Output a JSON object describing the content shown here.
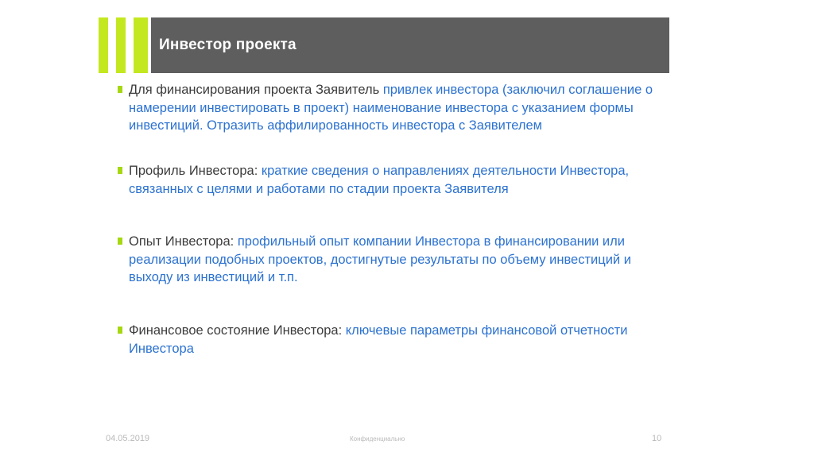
{
  "slide": {
    "title": "Инвестор проекта",
    "bullets": [
      {
        "lead": "Для финансирования проекта Заявитель ",
        "detail": "привлек инвестора (заключил соглашение о намерении инвестировать в проект) наименование инвестора с указанием формы инвестиций. Отразить аффилированность инвестора с Заявителем"
      },
      {
        "lead": "Профиль Инвестора: ",
        "detail": "краткие сведения о направлениях деятельности Инвестора, связанных с целями и работами по стадии проекта Заявителя"
      },
      {
        "lead": "Опыт Инвестора: ",
        "detail": "профильный опыт компании Инвестора в финансировании или реализации подобных проектов, достигнутые результаты по объему инвестиций и выходу из инвестиций и т.п."
      },
      {
        "lead": "Финансовое состояние Инвестора: ",
        "detail": "ключевые параметры финансовой отчетности Инвестора"
      }
    ]
  },
  "footer": {
    "date": "04.05.2019",
    "confidential": "Конфиденциально",
    "page": "10"
  },
  "colors": {
    "accent": "#c4e81f",
    "title_bar": "#5e5e5e",
    "detail_text": "#2c72d0"
  }
}
